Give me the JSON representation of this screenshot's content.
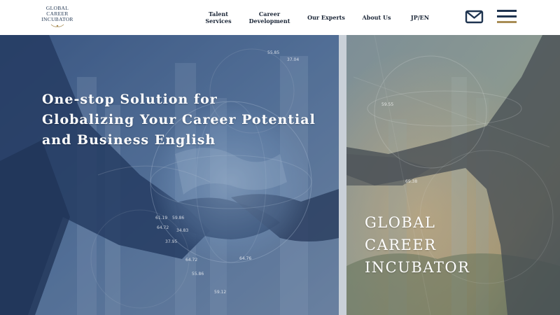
{
  "header": {
    "logo": {
      "line1": "GLOBAL",
      "line2": "CAREER",
      "line3": "INCUBATOR"
    },
    "nav": [
      {
        "id": "talent",
        "label": "Talent\nServices"
      },
      {
        "id": "career",
        "label": "Career\nDevelopment"
      },
      {
        "id": "experts",
        "label": "Our Experts"
      },
      {
        "id": "about",
        "label": "About Us"
      },
      {
        "id": "lang",
        "label": "JP/EN"
      }
    ],
    "icons": {
      "mail": "envelope-icon",
      "menu": "hamburger-menu-icon"
    }
  },
  "hero": {
    "headline": "One-stop Solution for\nGlobalizing Your Career Potential\nand Business English",
    "brand": "GLOBAL\nCAREER\nINCUBATOR",
    "hud_numbers": [
      "55.85",
      "37.04",
      "61.19",
      "59.86",
      "64.72",
      "34.83",
      "37.95",
      "64.76",
      "64.72",
      "55.86",
      "59.12",
      "59.55",
      "69.38"
    ]
  },
  "colors": {
    "navy": "#1f3450",
    "gold": "#a88d55",
    "nav_text": "#1a2536",
    "overlay_left": "#2e4a78",
    "overlay_right": "#7e8f8c"
  }
}
